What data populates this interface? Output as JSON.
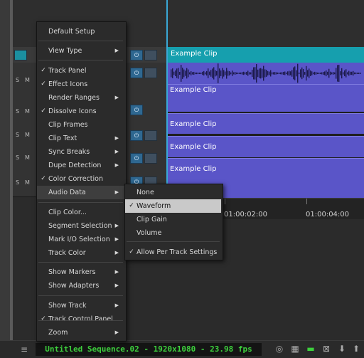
{
  "timeline": {
    "clip_label": "Example Clip",
    "clips": [
      "Example Clip",
      "Example Clip",
      "Example Clip",
      "Example Clip"
    ],
    "timecodes": [
      "01:00:02:00",
      "01:00:04:00"
    ],
    "track_buttons": {
      "s": "S",
      "m": "M"
    }
  },
  "context_menu": {
    "items": [
      {
        "label": "Default Setup",
        "checked": false,
        "submenu": false
      },
      {
        "label": "View Type",
        "checked": false,
        "submenu": true
      },
      {
        "label": "Track Panel",
        "checked": true,
        "submenu": false
      },
      {
        "label": "Effect Icons",
        "checked": true,
        "submenu": false
      },
      {
        "label": "Render Ranges",
        "checked": false,
        "submenu": true
      },
      {
        "label": "Dissolve Icons",
        "checked": true,
        "submenu": false
      },
      {
        "label": "Clip Frames",
        "checked": false,
        "submenu": false
      },
      {
        "label": "Clip Text",
        "checked": false,
        "submenu": true
      },
      {
        "label": "Sync Breaks",
        "checked": false,
        "submenu": true
      },
      {
        "label": "Dupe Detection",
        "checked": false,
        "submenu": true
      },
      {
        "label": "Color Correction",
        "checked": true,
        "submenu": false
      },
      {
        "label": "Audio Data",
        "checked": false,
        "submenu": true
      },
      {
        "label": "Clip Color...",
        "checked": false,
        "submenu": false
      },
      {
        "label": "Segment Selection",
        "checked": false,
        "submenu": true
      },
      {
        "label": "Mark I/O Selection",
        "checked": false,
        "submenu": true
      },
      {
        "label": "Track Color",
        "checked": false,
        "submenu": true
      },
      {
        "label": "Show Markers",
        "checked": false,
        "submenu": true
      },
      {
        "label": "Show Adapters",
        "checked": false,
        "submenu": true
      },
      {
        "label": "Show Track",
        "checked": false,
        "submenu": true
      },
      {
        "label": "Track Control Panel",
        "checked": true,
        "submenu": false
      },
      {
        "label": "Zoom",
        "checked": false,
        "submenu": true
      }
    ],
    "check_glyph": "✓",
    "arrow_glyph": "▶"
  },
  "audio_data_submenu": {
    "items": [
      {
        "label": "None",
        "checked": false
      },
      {
        "label": "Waveform",
        "checked": true
      },
      {
        "label": "Clip Gain",
        "checked": false
      },
      {
        "label": "Volume",
        "checked": false
      },
      {
        "label": "Allow Per Track Settings",
        "checked": true
      }
    ]
  },
  "status_bar": {
    "sequence_title": "Untitled Sequence.02 - 1920x1080 - 23.98 fps"
  },
  "colors": {
    "clip": "#5a55c8",
    "clip_header": "#169fae",
    "playhead": "#3aa8d6",
    "title_text": "#3dd13d"
  },
  "icons": [
    "hamburger-icon",
    "settings-icon",
    "layout-icon",
    "toggle-icon",
    "fullscreen-icon",
    "arrow-down-icon",
    "arrow-up-icon",
    "power-icon",
    "monitor-icon"
  ]
}
